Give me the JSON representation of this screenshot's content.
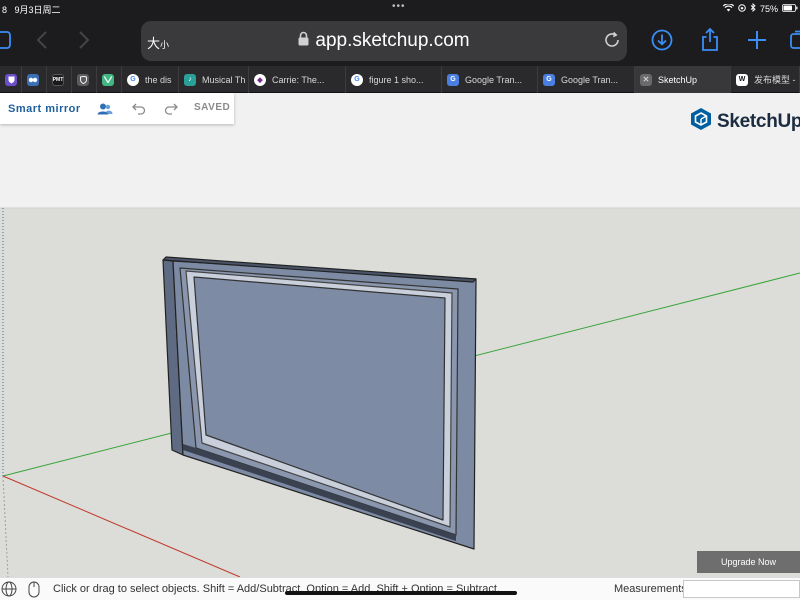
{
  "status_bar": {
    "time": "8",
    "date": "9月3日周二",
    "battery": "75%"
  },
  "toolbar": {
    "text_size_label": "大",
    "text_size_small": "小",
    "url": "app.sketchup.com"
  },
  "tabs": [
    {
      "label": "",
      "icon": "bitwarden-icon",
      "color": "#6a4fc9"
    },
    {
      "label": "",
      "icon": "app-icon",
      "color": "#3b6fb6"
    },
    {
      "label": "",
      "icon": "pmt-icon",
      "color": "#1a1a1a"
    },
    {
      "label": "",
      "icon": "shield-icon",
      "color": "#5c5c5c"
    },
    {
      "label": "",
      "icon": "vue-icon",
      "color": "#41b883"
    },
    {
      "label": "the dis",
      "icon": "google-icon",
      "color": "#ffffff"
    },
    {
      "label": "Musical Th",
      "icon": "musical-icon",
      "color": "#2aa198"
    },
    {
      "label": "Carrie: The...",
      "icon": "carrie-icon",
      "color": "#ffffff"
    },
    {
      "label": "figure 1 sho...",
      "icon": "google-icon",
      "color": "#ffffff"
    },
    {
      "label": "Google Tran...",
      "icon": "translate-icon",
      "color": "#4a7ee0"
    },
    {
      "label": "Google Tran...",
      "icon": "translate-icon",
      "color": "#4a7ee0"
    },
    {
      "label": "SketchUp",
      "icon": "close-icon",
      "color": "#888888",
      "active": true
    },
    {
      "label": "发布模型 -",
      "icon": "w-icon",
      "color": "#ffffff"
    }
  ],
  "document": {
    "title": "Smart mirror",
    "saved_label": "SAVED"
  },
  "brand": {
    "name": "SketchUp",
    "color": "#005f9e"
  },
  "upgrade_label": "Upgrade Now",
  "statusbar": {
    "hint": "Click or drag to select objects. Shift = Add/Subtract. Option = Add. Shift + Option = Subtract.",
    "measurements_label": "Measurements",
    "measurements_value": ""
  },
  "colors": {
    "accent": "#3a8ef6",
    "panel_title": "#1d5f9d",
    "model_frame": "#7c8aa3",
    "model_glass": "#7d8ba4",
    "axis_green": "#3aa53a",
    "axis_red": "#c0392b"
  }
}
